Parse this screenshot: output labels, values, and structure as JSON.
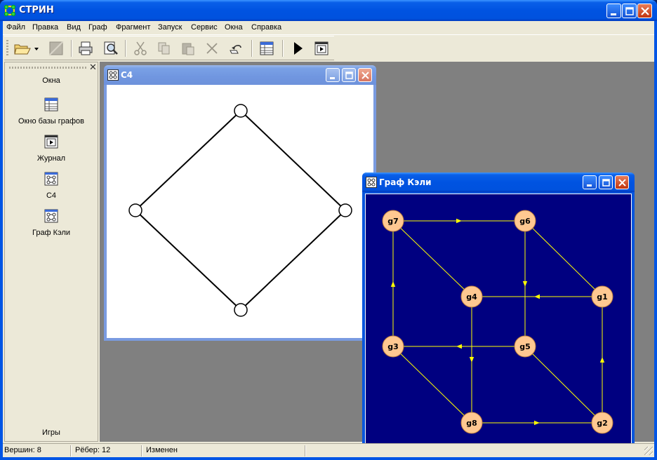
{
  "app": {
    "title": "СТРИН"
  },
  "menu": [
    "Файл",
    "Правка",
    "Вид",
    "Граф",
    "Фрагмент",
    "Запуск",
    "Сервис",
    "Окна",
    "Справка"
  ],
  "toolbar": {
    "buttons": [
      "open-icon",
      "save-icon",
      "print-icon",
      "preview-icon",
      "cut-icon",
      "copy-icon",
      "paste-icon",
      "delete-icon",
      "undo-icon",
      "graph-base-icon",
      "run-icon",
      "journal-icon"
    ]
  },
  "side_panel": {
    "header": "Окна",
    "footer": "Игры",
    "items": [
      {
        "label": "Окно базы графов",
        "icon": "graph-base-icon"
      },
      {
        "label": "Журнал",
        "icon": "journal-icon"
      },
      {
        "label": "C4",
        "icon": "graph-window-icon"
      },
      {
        "label": "Граф Кэли",
        "icon": "graph-window-icon"
      }
    ]
  },
  "windows": {
    "c4": {
      "title": "C4"
    },
    "cayley": {
      "title": "Граф Кэли",
      "background": "#000080",
      "node_color": "#ffc891",
      "edge_color": "#ffff00",
      "nodes": [
        "g1",
        "g2",
        "g3",
        "g4",
        "g5",
        "g6",
        "g7",
        "g8"
      ]
    }
  },
  "status": {
    "vertices": "Вершин: 8",
    "edges": "Рёбер: 12",
    "state": "Изменен"
  }
}
